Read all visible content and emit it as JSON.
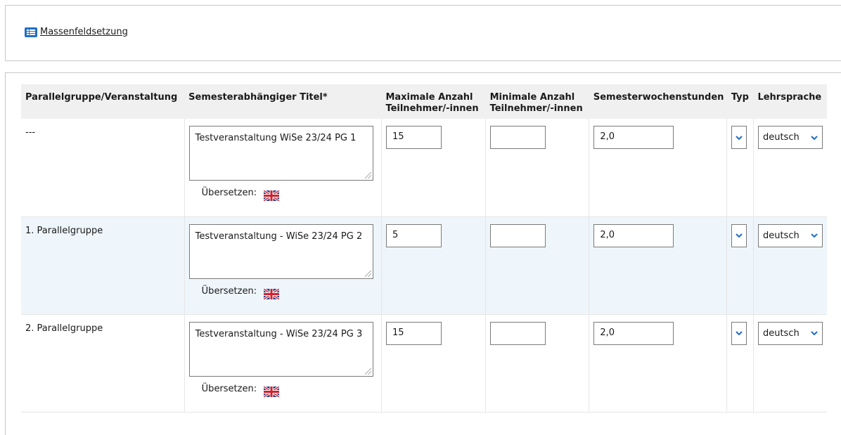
{
  "mass_link": {
    "label": "Massenfeldsetzung",
    "icon": "list-icon"
  },
  "table": {
    "headers": {
      "group": "Parallelgruppe/Veranstaltung",
      "title": "Semesterabhängiger Titel*",
      "max_line1": "Maximale Anzahl",
      "max_line2": "Teilnehmer/-innen",
      "min_line1": "Minimale Anzahl",
      "min_line2": "Teilnehmer/-innen",
      "sws": "Semesterwochenstunden",
      "typ": "Typ",
      "lang": "Lehrsprache"
    },
    "rows": [
      {
        "group": "---",
        "title": "Testveranstaltung WiSe 23/24 PG 1",
        "translate_label": "Übersetzen:",
        "max": "15",
        "min": "",
        "sws": "2,0",
        "typ": "",
        "lang": "deutsch"
      },
      {
        "group": "1. Parallelgruppe",
        "title": "Testveranstaltung - WiSe 23/24 PG 2",
        "translate_label": "Übersetzen:",
        "max": "5",
        "min": "",
        "sws": "2,0",
        "typ": "",
        "lang": "deutsch"
      },
      {
        "group": "2. Parallelgruppe",
        "title": "Testveranstaltung - WiSe 23/24 PG 3",
        "translate_label": "Übersetzen:",
        "max": "15",
        "min": "",
        "sws": "2,0",
        "typ": "",
        "lang": "deutsch"
      }
    ]
  },
  "colors": {
    "accent": "#1f6fc5",
    "row_alt": "#eef6fc",
    "header_bg": "#f0f0f0"
  }
}
